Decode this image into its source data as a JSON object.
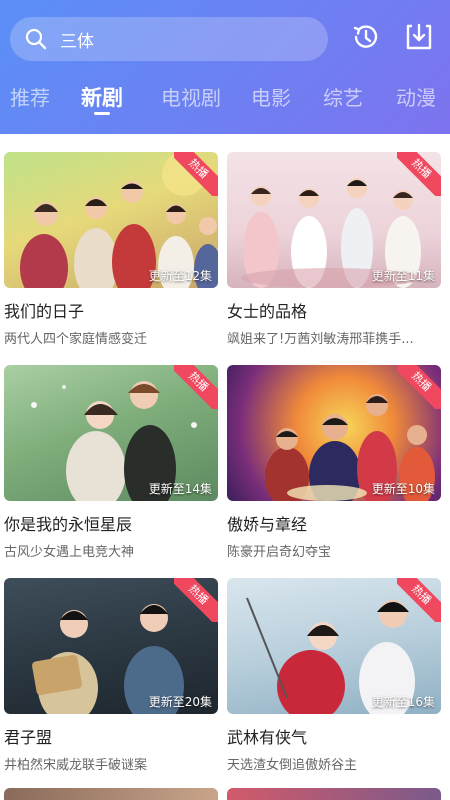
{
  "search": {
    "query": "三体"
  },
  "icons": {
    "search": "search-icon",
    "history": "history-icon",
    "download": "download-icon"
  },
  "tabs": [
    {
      "label": "推荐"
    },
    {
      "label": "新剧"
    },
    {
      "label": "电视剧"
    },
    {
      "label": "电影"
    },
    {
      "label": "综艺"
    },
    {
      "label": "动漫"
    }
  ],
  "active_tab": "新剧",
  "cards": [
    {
      "title": "我们的日子",
      "desc": "两代人四个家庭情感变迁",
      "episodes": "更新至12集",
      "badge": "热播"
    },
    {
      "title": "女士的品格",
      "desc": "飒姐来了!万茜刘敏涛邢菲携手...",
      "episodes": "更新至11集",
      "badge": "热播"
    },
    {
      "title": "你是我的永恒星辰",
      "desc": "古风少女遇上电竞大神",
      "episodes": "更新至14集",
      "badge": "热播"
    },
    {
      "title": "傲娇与章经",
      "desc": "陈豪开启奇幻夺宝",
      "episodes": "更新至10集",
      "badge": "热播"
    },
    {
      "title": "君子盟",
      "desc": "井柏然宋威龙联手破谜案",
      "episodes": "更新至20集",
      "badge": "热播"
    },
    {
      "title": "武林有侠气",
      "desc": "天选渣女倒追傲娇谷主",
      "episodes": "更新至16集",
      "badge": "热播"
    }
  ],
  "colors": {
    "header_start": "#5b8ff6",
    "header_end": "#7d73ee",
    "badge": "#f0485f",
    "title_text": "#222222",
    "desc_text": "#666666"
  }
}
